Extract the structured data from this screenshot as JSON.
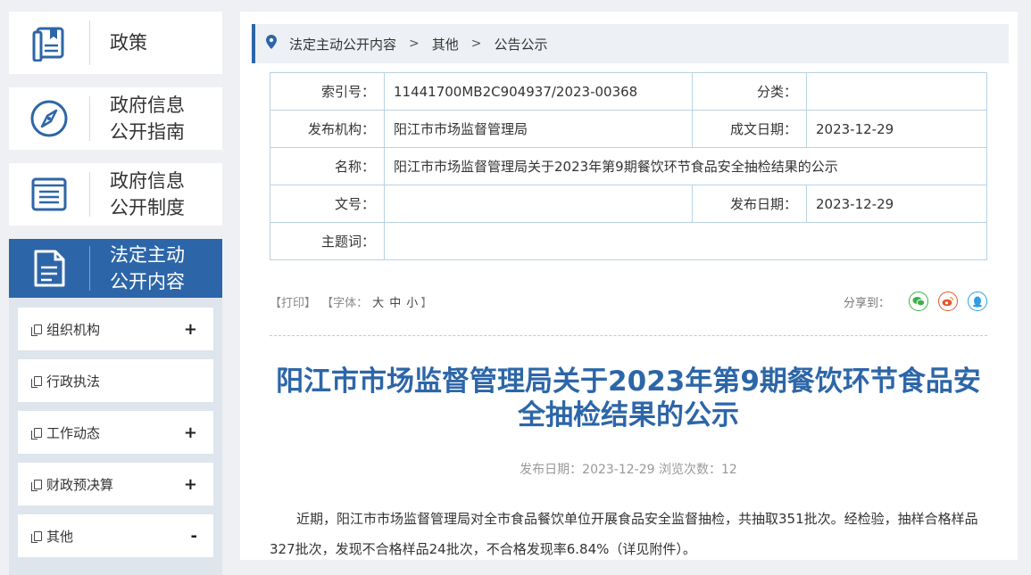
{
  "sidebar": {
    "big_items": [
      {
        "icon": "book-icon",
        "label": "政策"
      },
      {
        "icon": "compass-icon",
        "label": "政府信息公开指南"
      },
      {
        "icon": "list-doc-icon",
        "label": "政府信息公开制度"
      },
      {
        "icon": "document-icon",
        "label": "法定主动公开内容"
      }
    ],
    "big_lines": {
      "b1a": "政府信息",
      "b1b": "公开指南",
      "b2a": "政府信息",
      "b2b": "公开制度",
      "b3a": "法定主动",
      "b3b": "公开内容"
    },
    "sub_items": [
      {
        "label": "组织机构",
        "sign": "+"
      },
      {
        "label": "行政执法",
        "sign": ""
      },
      {
        "label": "工作动态",
        "sign": "+"
      },
      {
        "label": "财政预决算",
        "sign": "+"
      },
      {
        "label": "其他",
        "sign": "-"
      }
    ]
  },
  "breadcrumb": {
    "items": [
      "法定主动公开内容",
      "其他",
      "公告公示"
    ],
    "separator": ">"
  },
  "meta": {
    "index_label": "索引号：",
    "index_value": "11441700MB2C904937/2023-00368",
    "category_label": "分类：",
    "category_value": "",
    "publisher_label": "发布机构：",
    "publisher_value": "阳江市市场监督管理局",
    "written_date_label": "成文日期：",
    "written_date_value": "2023-12-29",
    "name_label": "名称：",
    "name_value": "阳江市市场监督管理局关于2023年第9期餐饮环节食品安全抽检结果的公示",
    "doc_no_label": "文号：",
    "doc_no_value": "",
    "publish_date_label": "发布日期：",
    "publish_date_value": "2023-12-29",
    "keywords_label": "主题词：",
    "keywords_value": ""
  },
  "tools": {
    "print": "【打印】",
    "font_prefix": "【字体：",
    "font_large": "大",
    "font_medium": "中",
    "font_small": "小",
    "font_suffix": "】",
    "share_label": "分享到："
  },
  "article": {
    "title": "阳江市市场监督管理局关于2023年第9期餐饮环节食品安全抽检结果的公示",
    "pub_info": "发布日期：2023-12-29  浏览次数：12",
    "body": "近期，阳江市市场监督管理局对全市食品餐饮单位开展食品安全监督抽检，共抽取351批次。经检验，抽样合格样品327批次，发现不合格样品24批次，不合格发现率6.84%（详见附件）。"
  },
  "colors": {
    "accent": "#2d66a8",
    "wechat": "#3db04a",
    "weibo": "#e4572e",
    "qq": "#2e9de6"
  }
}
